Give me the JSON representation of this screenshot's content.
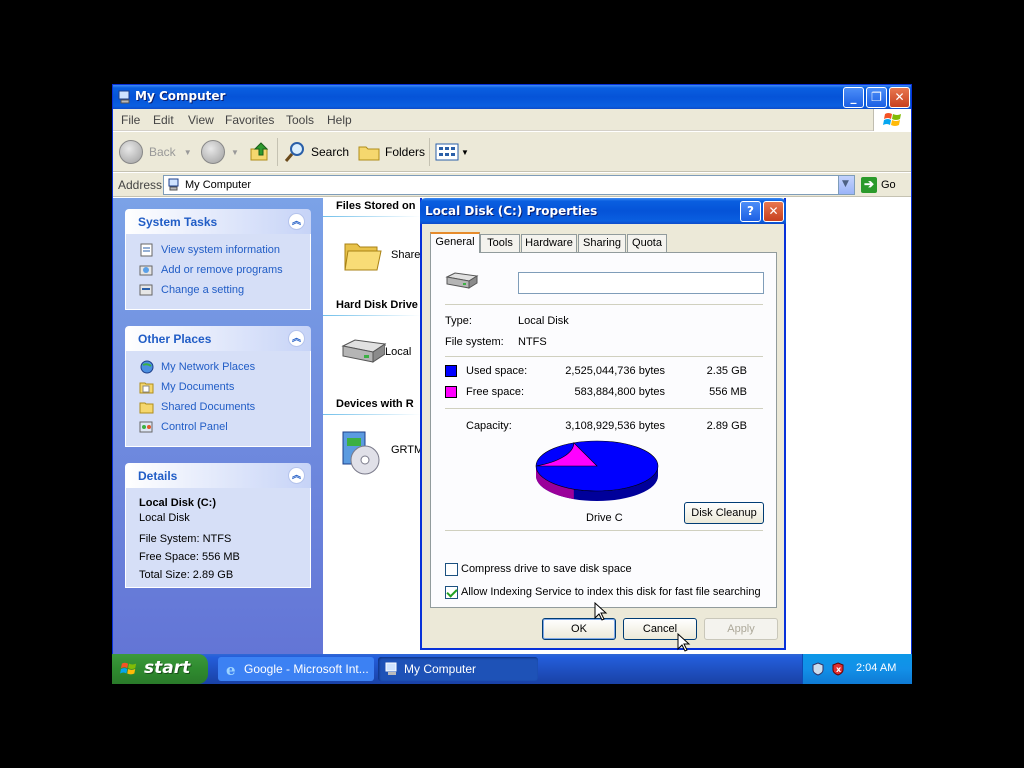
{
  "window": {
    "title": "My Computer",
    "menu": [
      "File",
      "Edit",
      "View",
      "Favorites",
      "Tools",
      "Help"
    ],
    "toolbar": {
      "back": "Back",
      "search": "Search",
      "folders": "Folders"
    },
    "address": {
      "label": "Address",
      "value": "My Computer",
      "go": "Go"
    }
  },
  "leftpane": {
    "system_tasks": {
      "title": "System Tasks",
      "items": [
        "View system information",
        "Add or remove programs",
        "Change a setting"
      ]
    },
    "other_places": {
      "title": "Other Places",
      "items": [
        "My Network Places",
        "My Documents",
        "Shared Documents",
        "Control Panel"
      ]
    },
    "details": {
      "title": "Details",
      "name": "Local Disk (C:)",
      "type": "Local Disk",
      "fs": "File System: NTFS",
      "free": "Free Space: 556 MB",
      "total": "Total Size: 2.89 GB"
    }
  },
  "content": {
    "groups": [
      "Files Stored on",
      "Hard Disk Drive",
      "Devices with R"
    ],
    "items": [
      "Share",
      "Local",
      "GRTM"
    ]
  },
  "dialog": {
    "title": "Local Disk (C:) Properties",
    "tabs": [
      "General",
      "Tools",
      "Hardware",
      "Sharing",
      "Quota"
    ],
    "name_value": "",
    "type_label": "Type:",
    "type_value": "Local Disk",
    "fs_label": "File system:",
    "fs_value": "NTFS",
    "used_label": "Used space:",
    "used_bytes": "2,525,044,736 bytes",
    "used_size": "2.35 GB",
    "free_label": "Free space:",
    "free_bytes": "583,884,800 bytes",
    "free_size": "556 MB",
    "cap_label": "Capacity:",
    "cap_bytes": "3,108,929,536 bytes",
    "cap_size": "2.89 GB",
    "drive_label": "Drive C",
    "cleanup": "Disk Cleanup",
    "compress": "Compress drive to save disk space",
    "compress_checked": false,
    "indexing": "Allow Indexing Service to index this disk for fast file searching",
    "indexing_checked": true,
    "ok": "OK",
    "cancel": "Cancel",
    "apply": "Apply",
    "colors": {
      "used": "#0000ff",
      "free": "#ff00ff"
    },
    "used_fraction": 0.812
  },
  "taskbar": {
    "start": "start",
    "items": [
      "Google - Microsoft Int...",
      "My Computer"
    ],
    "clock": "2:04 AM"
  }
}
